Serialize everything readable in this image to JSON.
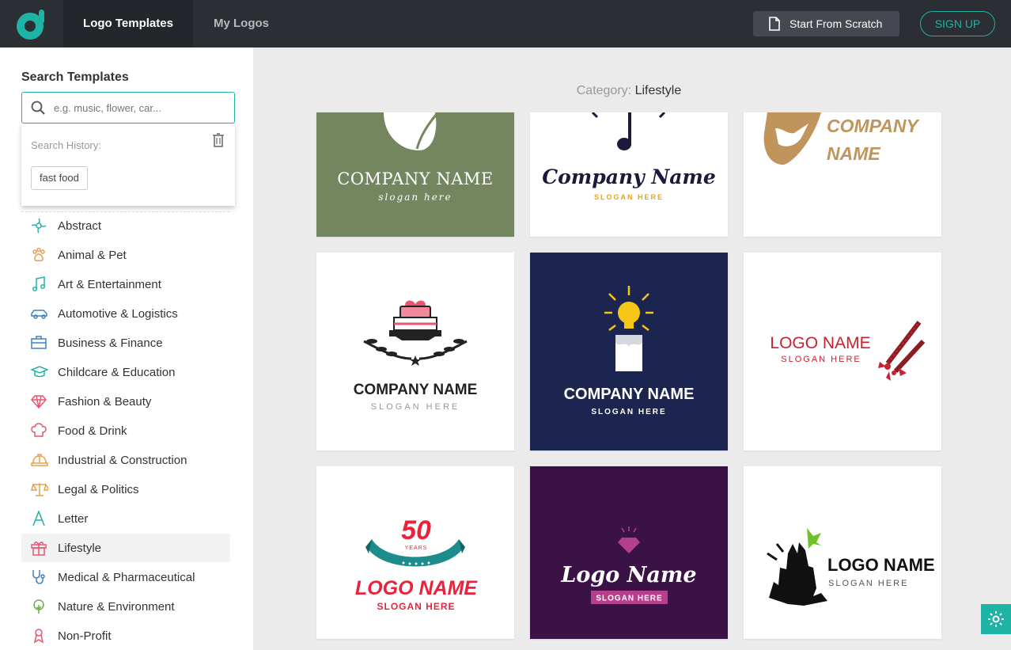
{
  "header": {
    "tabs": [
      {
        "label": "Logo Templates"
      },
      {
        "label": "My Logos"
      }
    ],
    "scratch_label": "Start From Scratch",
    "signup_label": "SIGN UP"
  },
  "sidebar": {
    "search_title": "Search Templates",
    "search_placeholder": "e.g. music, flower, car...",
    "history_label": "Search History:",
    "history_items": [
      "fast food"
    ],
    "categories": [
      {
        "label": "Abstract",
        "icon": "abstract-icon",
        "color": "#1fb3a6"
      },
      {
        "label": "Animal & Pet",
        "icon": "paw-icon",
        "color": "#e8a04d"
      },
      {
        "label": "Art & Entertainment",
        "icon": "music-note-icon",
        "color": "#1fb3a6"
      },
      {
        "label": "Automotive & Logistics",
        "icon": "car-icon",
        "color": "#3b82c4"
      },
      {
        "label": "Business & Finance",
        "icon": "briefcase-icon",
        "color": "#3b82c4"
      },
      {
        "label": "Childcare & Education",
        "icon": "graduation-cap-icon",
        "color": "#1fb3a6"
      },
      {
        "label": "Fashion & Beauty",
        "icon": "diamond-icon",
        "color": "#e8556d"
      },
      {
        "label": "Food & Drink",
        "icon": "chef-hat-icon",
        "color": "#e8556d"
      },
      {
        "label": "Industrial & Construction",
        "icon": "hard-hat-icon",
        "color": "#e8a04d"
      },
      {
        "label": "Legal & Politics",
        "icon": "scales-icon",
        "color": "#e8a04d"
      },
      {
        "label": "Letter",
        "icon": "letter-a-icon",
        "color": "#1fb3a6"
      },
      {
        "label": "Lifestyle",
        "icon": "gift-icon",
        "color": "#e8556d"
      },
      {
        "label": "Medical & Pharmaceutical",
        "icon": "stethoscope-icon",
        "color": "#3b82c4"
      },
      {
        "label": "Nature & Environment",
        "icon": "tree-icon",
        "color": "#6ab04c"
      },
      {
        "label": "Non-Profit",
        "icon": "ribbon-icon",
        "color": "#e8556d"
      }
    ]
  },
  "main": {
    "category_prefix": "Category:",
    "category_name": "Lifestyle",
    "cards": [
      {
        "name": "COMPANY NAME",
        "slogan": "slogan here",
        "bg": "#738660"
      },
      {
        "name": "Company Name",
        "slogan": "SLOGAN HERE",
        "bg": "#ffffff"
      },
      {
        "name1": "COMPANY",
        "name2": "NAME",
        "bg": "#ffffff"
      },
      {
        "name": "COMPANY NAME",
        "slogan": "SLOGAN HERE",
        "bg": "#ffffff"
      },
      {
        "name": "COMPANY  NAME",
        "slogan": "SLOGAN HERE",
        "bg": "#1b2550"
      },
      {
        "name": "LOGO NAME",
        "slogan": "SLOGAN HERE",
        "bg": "#ffffff"
      },
      {
        "number": "50",
        "years": "YEARS",
        "name": "LOGO NAME",
        "slogan": "SLOGAN HERE",
        "bg": "#ffffff"
      },
      {
        "name": "Logo Name",
        "slogan": "SLOGAN HERE",
        "bg": "#3a1245"
      },
      {
        "name": "LOGO NAME",
        "slogan": "SLOGAN HERE",
        "bg": "#ffffff"
      }
    ]
  }
}
